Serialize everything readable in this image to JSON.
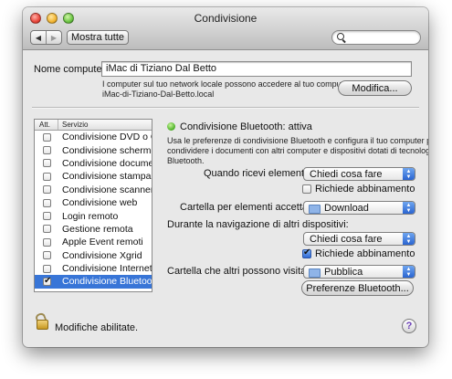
{
  "window": {
    "title": "Condivisione"
  },
  "toolbar": {
    "back_label": "◀",
    "forward_label": "▶",
    "show_all_label": "Mostra tutte",
    "search_placeholder": ""
  },
  "computer_name": {
    "label": "Nome computer:",
    "value": "iMac di Tiziano Dal Betto",
    "info_line1": "I computer sul tuo network locale possono accedere al tuo computer su:",
    "info_line2": "iMac-di-Tiziano-Dal-Betto.local",
    "edit_button": "Modifica..."
  },
  "services": {
    "col_on": "Att.",
    "col_service": "Servizio",
    "items": [
      {
        "label": "Condivisione DVD o CD",
        "checked": false,
        "selected": false
      },
      {
        "label": "Condivisione schermo",
        "checked": false,
        "selected": false
      },
      {
        "label": "Condivisione documenti",
        "checked": false,
        "selected": false
      },
      {
        "label": "Condivisione stampante",
        "checked": false,
        "selected": false
      },
      {
        "label": "Condivisione scanner",
        "checked": false,
        "selected": false
      },
      {
        "label": "Condivisione web",
        "checked": false,
        "selected": false
      },
      {
        "label": "Login remoto",
        "checked": false,
        "selected": false
      },
      {
        "label": "Gestione remota",
        "checked": false,
        "selected": false
      },
      {
        "label": "Apple Event remoti",
        "checked": false,
        "selected": false
      },
      {
        "label": "Condivisione Xgrid",
        "checked": false,
        "selected": false
      },
      {
        "label": "Condivisione Internet",
        "checked": false,
        "selected": false
      },
      {
        "label": "Condivisione Bluetooth",
        "checked": true,
        "selected": true
      }
    ]
  },
  "bluetooth": {
    "status": "Condivisione Bluetooth: attiva",
    "description_line1": "Usa le preferenze di condivisione Bluetooth e configura il tuo computer per",
    "description_line2": "condividere i documenti con altri computer e dispositivi dotati di tecnologia",
    "description_line3": "Bluetooth.",
    "receive_label": "Quando ricevi elementi:",
    "receive_value": "Chiedi cosa fare",
    "receive_pairing_label": "Richiede abbinamento",
    "receive_pairing_checked": false,
    "accepted_folder_label": "Cartella per elementi accettati:",
    "accepted_folder_value": "Download",
    "browse_label": "Durante la navigazione di altri dispositivi:",
    "browse_value": "Chiedi cosa fare",
    "browse_pairing_label": "Richiede abbinamento",
    "browse_pairing_checked": true,
    "visit_folder_label": "Cartella che altri possono visitare:",
    "visit_folder_value": "Pubblica",
    "prefs_button": "Preferenze Bluetooth..."
  },
  "footer": {
    "lock_text": "Modifiche abilitate.",
    "help_label": "?"
  },
  "colors": {
    "selection": "#3875d7",
    "status_green": "#4fb32a",
    "popup_arrow": "#2a64d0"
  }
}
